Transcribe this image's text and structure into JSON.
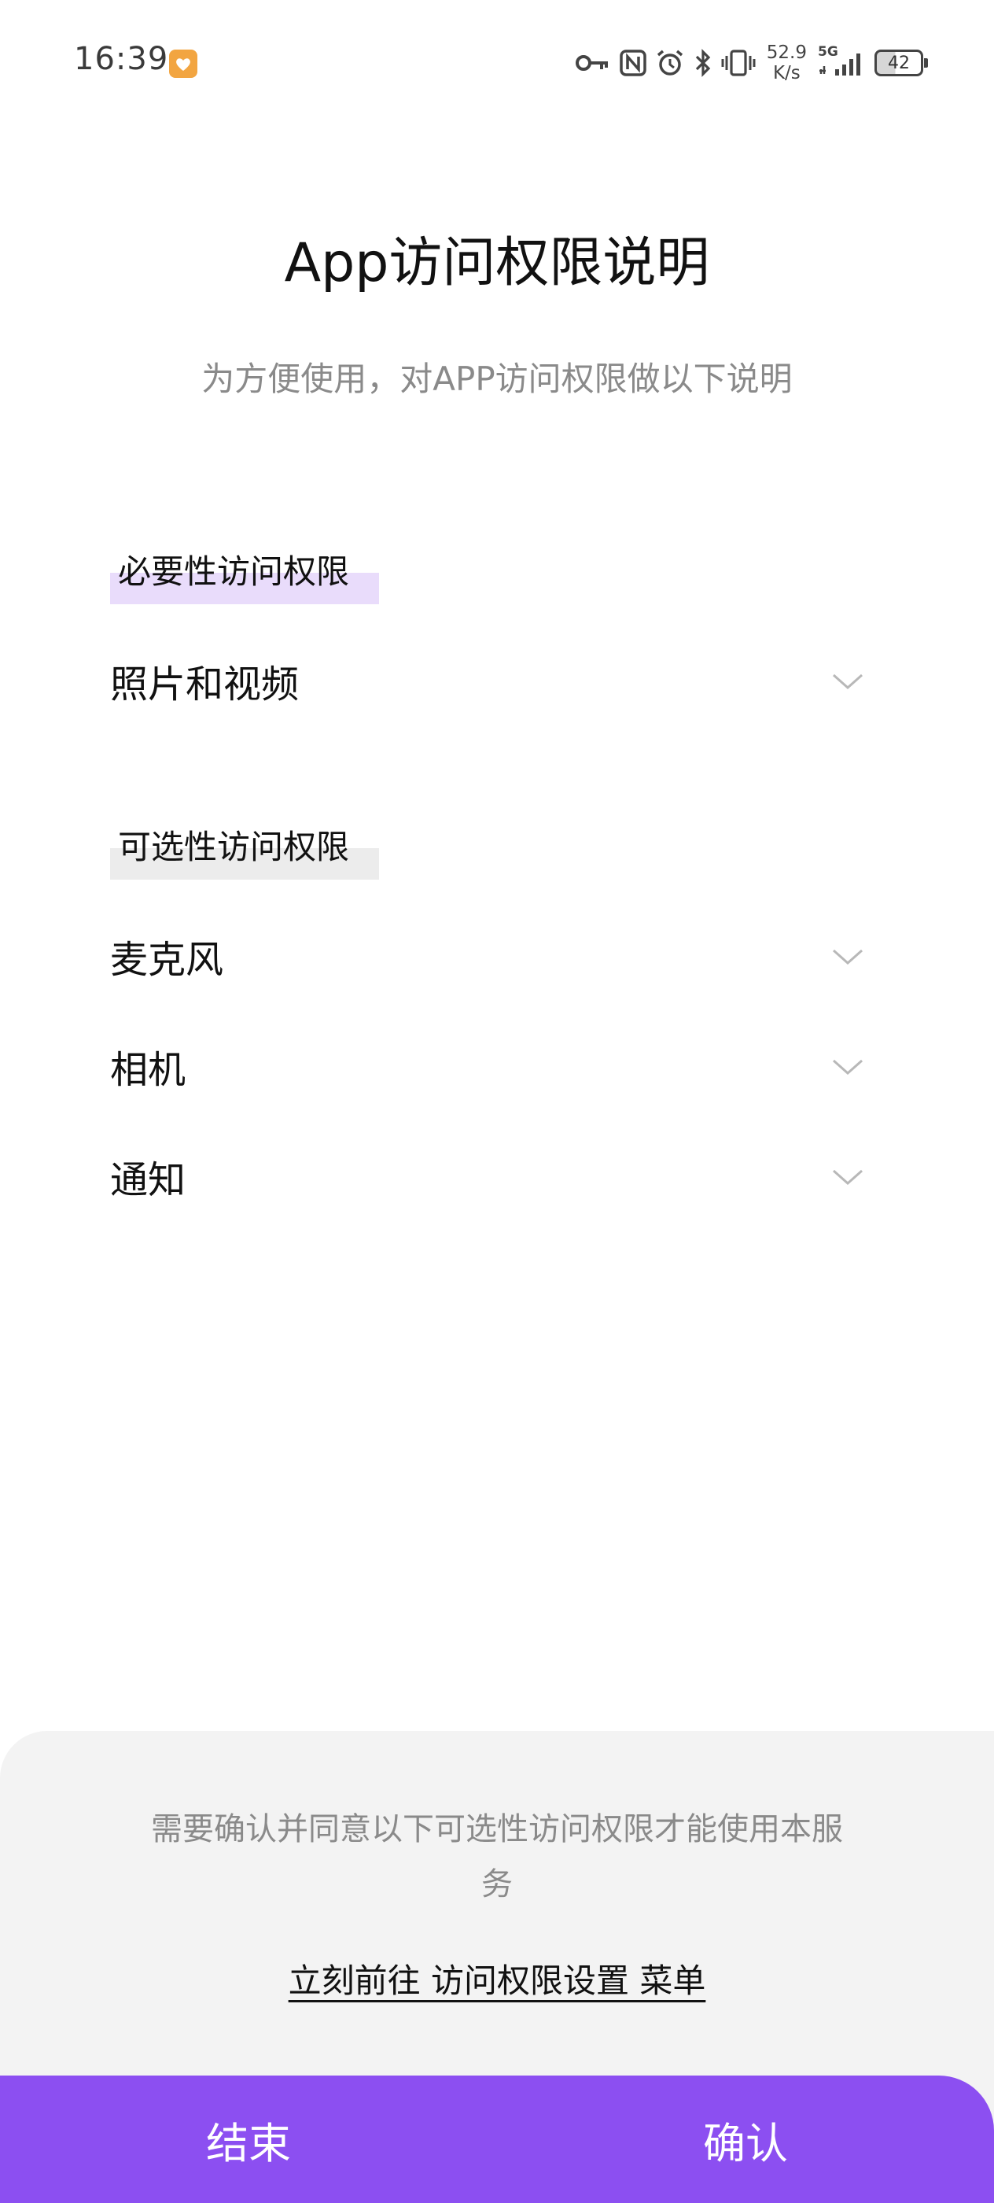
{
  "status_bar": {
    "time": "16:39",
    "net_speed_value": "52.9",
    "net_speed_unit": "K/s",
    "network_type": "5G",
    "battery": "42",
    "icons": [
      "key-icon",
      "nfc-icon",
      "alarm-icon",
      "bluetooth-icon",
      "vibrate-icon",
      "signal-icon",
      "battery-icon"
    ]
  },
  "header": {
    "title": "App访问权限说明",
    "subtitle": "为方便使用，对APP访问权限做以下说明"
  },
  "sections": {
    "required": {
      "title": "必要性访问权限",
      "items": [
        {
          "label": "照片和视频"
        }
      ]
    },
    "optional": {
      "title": "可选性访问权限",
      "items": [
        {
          "label": "麦克风"
        },
        {
          "label": "相机"
        },
        {
          "label": "通知"
        }
      ]
    }
  },
  "footer": {
    "notice": "需要确认并同意以下可选性访问权限才能使用本服务",
    "settings_link": "立刻前往 访问权限设置 菜单",
    "end_button": "结束",
    "confirm_button": "确认"
  },
  "colors": {
    "accent": "#8c4ff1",
    "required_highlight": "#e9dcfb",
    "optional_highlight": "#ececec",
    "footer_background": "#f3f3f3",
    "secondary_text": "#8a8a8a"
  }
}
